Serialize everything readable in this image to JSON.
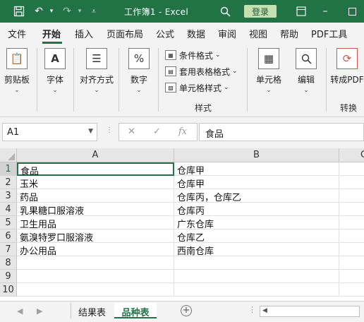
{
  "titlebar": {
    "title": "工作簿1  -  Excel",
    "login_label": "登录"
  },
  "tabs": [
    "文件",
    "开始",
    "插入",
    "页面布局",
    "公式",
    "数据",
    "审阅",
    "视图",
    "帮助",
    "PDF工具"
  ],
  "active_tab": "开始",
  "ribbon": {
    "clipboard_label": "剪贴板",
    "font_label": "字体",
    "align_label": "对齐方式",
    "number_label": "数字",
    "cond_format_label": "条件格式",
    "table_format_label": "套用表格格式",
    "cell_style_label": "单元格样式",
    "styles_group_label": "样式",
    "cells_label": "单元格",
    "edit_label": "编辑",
    "to_pdf_label": "转成PDF",
    "convert_group_label": "转换"
  },
  "formula_bar": {
    "name_box": "A1",
    "fx": "fx",
    "content": "食品"
  },
  "sheet": {
    "columns": [
      "A",
      "B",
      "C"
    ],
    "rows": [
      {
        "num": "1",
        "a": "食品",
        "b": "仓库甲"
      },
      {
        "num": "2",
        "a": "玉米",
        "b": "仓库甲"
      },
      {
        "num": "3",
        "a": "药品",
        "b": "仓库丙，仓库乙"
      },
      {
        "num": "4",
        "a": "乳果糖口服溶液",
        "b": "仓库丙"
      },
      {
        "num": "5",
        "a": "卫生用品",
        "b": "广东仓库"
      },
      {
        "num": "6",
        "a": "氨溴特罗口服溶液",
        "b": "仓库乙"
      },
      {
        "num": "7",
        "a": "办公用品",
        "b": "西南仓库"
      },
      {
        "num": "8",
        "a": "",
        "b": ""
      },
      {
        "num": "9",
        "a": "",
        "b": ""
      },
      {
        "num": "10",
        "a": "",
        "b": ""
      }
    ]
  },
  "sheet_tabs": [
    "结果表",
    "品种表"
  ],
  "active_sheet": "品种表",
  "colors": {
    "accent": "#217346",
    "login_bg": "#c6e0b4"
  }
}
